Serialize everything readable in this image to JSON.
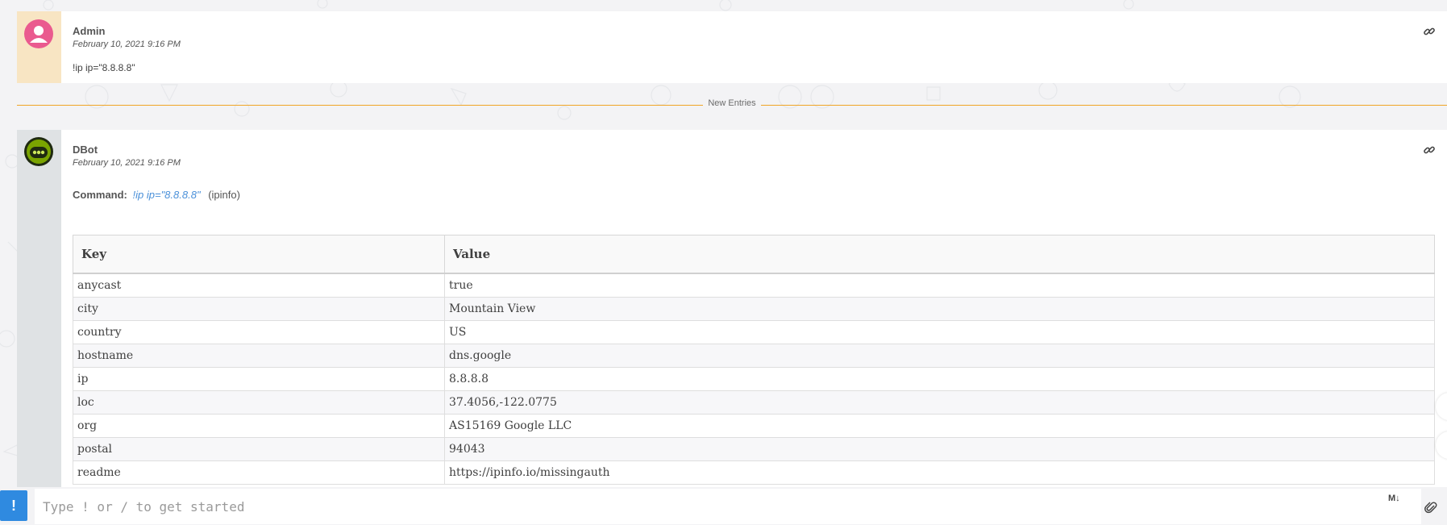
{
  "colors": {
    "accent": "#2f8ae0",
    "divider": "#f0a526",
    "admin_side": "#f8e5c3",
    "admin_avatar": "#ea5a8f",
    "dbot_side": "#dfe2e4",
    "dbot_avatar": "#7aa400",
    "link": "#4a90d9"
  },
  "entries": [
    {
      "author": "Admin",
      "time": "February 10, 2021 9:16 PM",
      "content": "!ip ip=\"8.8.8.8\"",
      "avatar_icon": "user-avatar-icon",
      "link_icon": "link-icon"
    },
    {
      "author": "DBot",
      "time": "February 10, 2021 9:16 PM",
      "command_label": "Command:",
      "command_text": "!ip ip=\"8.8.8.8\"",
      "integration": "(ipinfo)",
      "avatar_icon": "bot-avatar-icon",
      "link_icon": "link-icon"
    }
  ],
  "divider_label": "New Entries",
  "table": {
    "headers": [
      "Key",
      "Value"
    ],
    "rows": [
      [
        "anycast",
        "true"
      ],
      [
        "city",
        "Mountain View"
      ],
      [
        "country",
        "US"
      ],
      [
        "hostname",
        "dns.google"
      ],
      [
        "ip",
        "8.8.8.8"
      ],
      [
        "loc",
        "37.4056,-122.0775"
      ],
      [
        "org",
        "AS15169 Google LLC"
      ],
      [
        "postal",
        "94043"
      ],
      [
        "readme",
        "https://ipinfo.io/missingauth"
      ]
    ]
  },
  "input": {
    "placeholder": "Type ! or / to get started",
    "bang_label": "!",
    "markdown_label": "M↓"
  }
}
